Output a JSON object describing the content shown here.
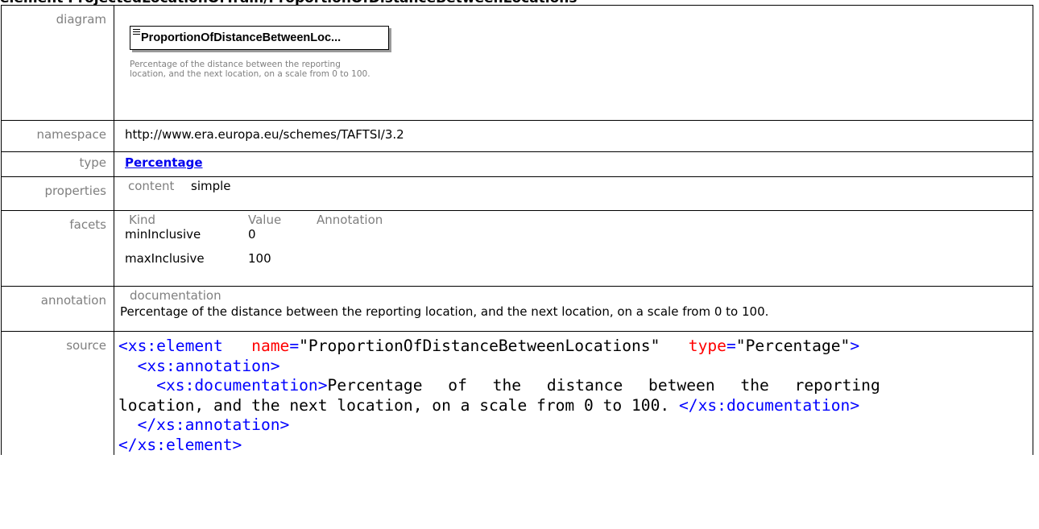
{
  "heading": "element ProjectedLocationOfTrain/ProportionOfDistanceBetweenLocations",
  "labels": {
    "diagram": "diagram",
    "namespace": "namespace",
    "type": "type",
    "properties": "properties",
    "facets": "facets",
    "annotation": "annotation",
    "source": "source"
  },
  "diagram": {
    "box_label": "ProportionOfDistanceBetweenLoc...",
    "doc": "Percentage of the distance between the reporting location, and the next location, on a scale from 0 to 100."
  },
  "namespace": "http://www.era.europa.eu/schemes/TAFTSI/3.2",
  "type": "Percentage",
  "properties": {
    "key": "content",
    "value": "simple"
  },
  "facets": {
    "headers": [
      "Kind",
      "Value",
      "Annotation"
    ],
    "rows": [
      {
        "kind": "minInclusive",
        "value": "0"
      },
      {
        "kind": "maxInclusive",
        "value": "100"
      }
    ]
  },
  "annotation": {
    "header": "documentation",
    "text": "Percentage of the distance between the reporting location, and the next location, on a scale from 0 to 100."
  },
  "source": {
    "open_tag": "<xs:element",
    "attr1_name": "name",
    "attr1_value": "\"ProportionOfDistanceBetweenLocations\"",
    "attr2_name": "type",
    "attr2_value": "\"Percentage\"",
    "open_tag_end": ">",
    "annotation_open": "<xs:annotation>",
    "documentation_open": "<xs:documentation>",
    "doc_text_1": "Percentage of the distance between the reporting",
    "doc_text_2": "location, and the next location, on a scale from 0 to 100. ",
    "documentation_close": "</xs:documentation>",
    "annotation_close": "</xs:annotation>",
    "element_close": "</xs:element>"
  }
}
